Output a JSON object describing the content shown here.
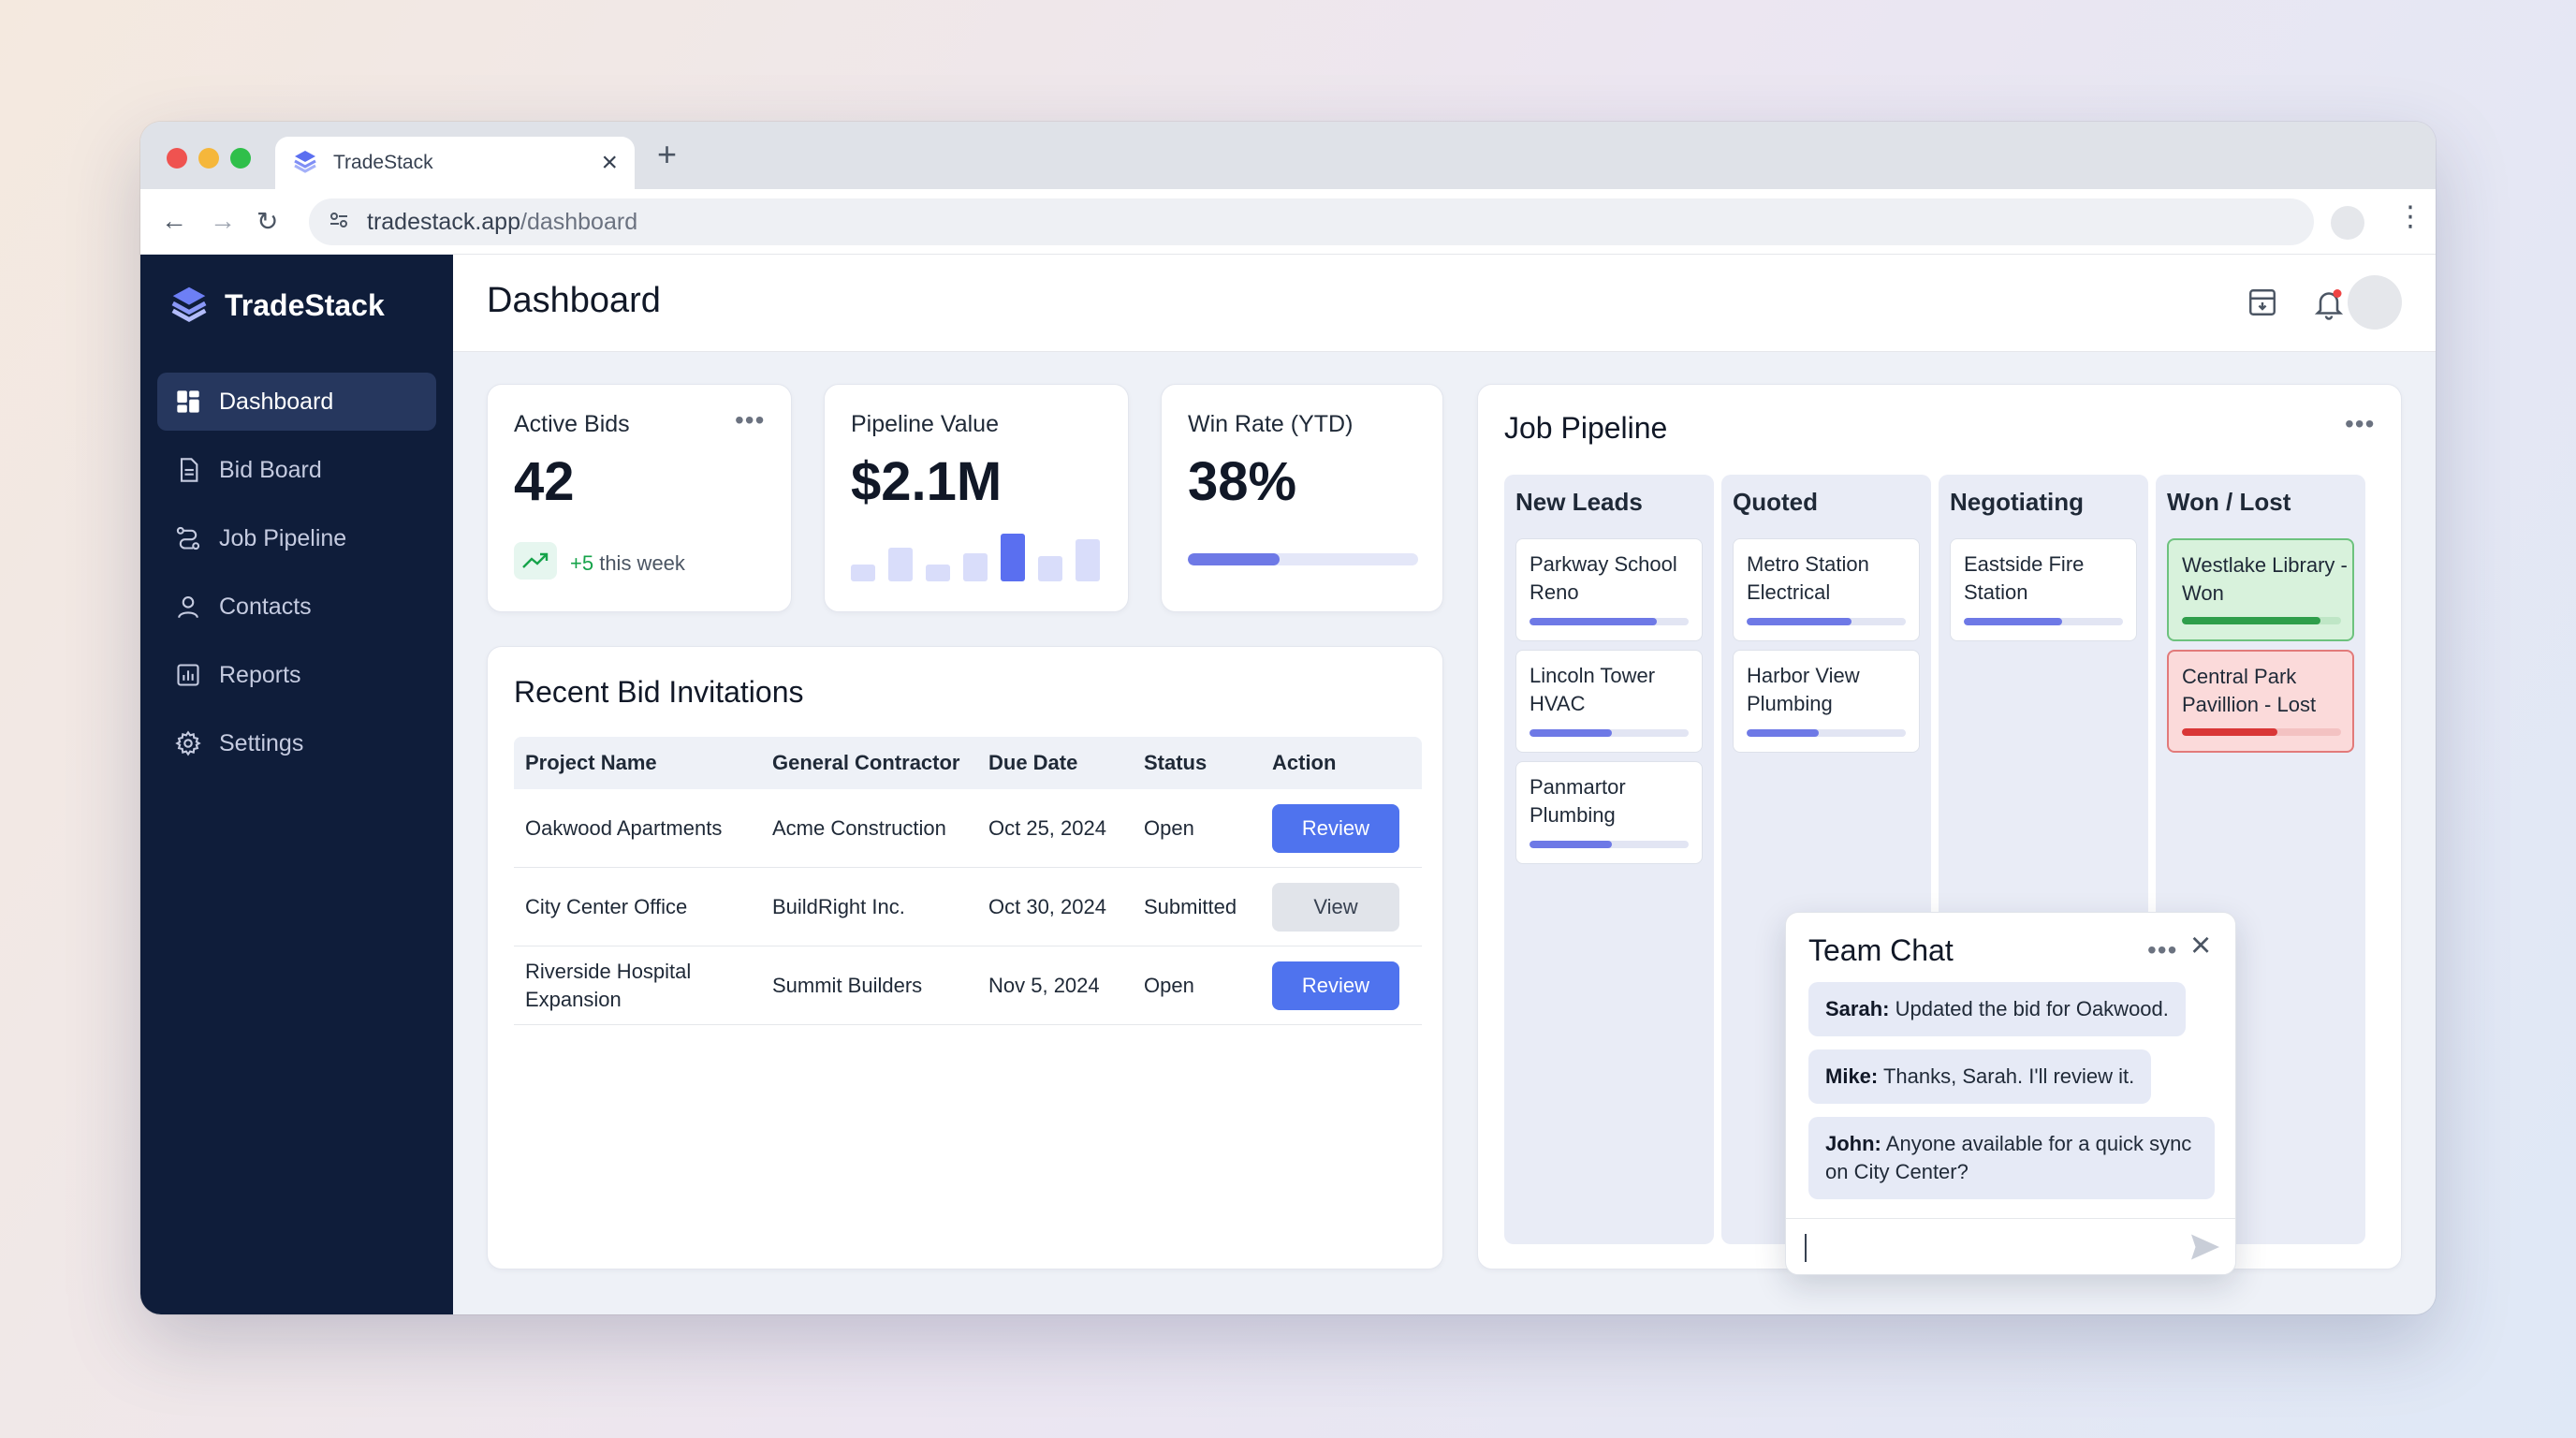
{
  "browser": {
    "tab_title": "TradeStack",
    "tab_close": "×",
    "new_tab": "+",
    "url_host": "tradestack.app",
    "url_path": "/dashboard",
    "traffic_colors": [
      "#ef5350",
      "#f5b73b",
      "#2fbf4a"
    ]
  },
  "sidebar": {
    "brand": "TradeStack",
    "items": [
      {
        "label": "Dashboard",
        "icon": "dashboard-icon",
        "active": true
      },
      {
        "label": "Bid Board",
        "icon": "document-icon",
        "active": false
      },
      {
        "label": "Job Pipeline",
        "icon": "pipeline-icon",
        "active": false
      },
      {
        "label": "Contacts",
        "icon": "user-icon",
        "active": false
      },
      {
        "label": "Reports",
        "icon": "chart-icon",
        "active": false
      },
      {
        "label": "Settings",
        "icon": "gear-icon",
        "active": false
      }
    ]
  },
  "header": {
    "title": "Dashboard",
    "icons": [
      "archive-icon",
      "bell-icon",
      "avatar"
    ],
    "notification_dot_color": "#ef4444"
  },
  "stats": {
    "active_bids": {
      "label": "Active Bids",
      "value": "42",
      "trend": "+5",
      "trend_suffix": " this week"
    },
    "pipeline_value": {
      "label": "Pipeline Value",
      "value": "$2.1M",
      "bar_levels": [
        0.3,
        0.6,
        0.3,
        0.5,
        0.85,
        0.45,
        0.75
      ],
      "highlight_index": 4
    },
    "win_rate": {
      "label": "Win Rate (YTD)",
      "value": "38%",
      "progress": 0.4
    }
  },
  "bids": {
    "title": "Recent Bid Invitations",
    "columns": [
      "Project Name",
      "General Contractor",
      "Due Date",
      "Status",
      "Action"
    ],
    "rows": [
      {
        "project": "Oakwood Apartments",
        "contractor": "Acme Construction",
        "due": "Oct 25, 2024",
        "status": "Open",
        "action": "Review",
        "primary": true
      },
      {
        "project": "City Center Office",
        "contractor": "BuildRight Inc.",
        "due": "Oct 30, 2024",
        "status": "Submitted",
        "action": "View",
        "primary": false
      },
      {
        "project": "Riverside Hospital Expansion",
        "contractor": "Summit Builders",
        "due": "Nov 5, 2024",
        "status": "Open",
        "action": "Review",
        "primary": true
      }
    ]
  },
  "pipeline": {
    "title": "Job Pipeline",
    "columns": [
      {
        "title": "New Leads",
        "cards": [
          {
            "name": "Parkway School Reno",
            "progress": 0.8,
            "state": "normal"
          },
          {
            "name": "Lincoln Tower HVAC",
            "progress": 0.52,
            "state": "normal"
          },
          {
            "name": "Panmartor Plumbing",
            "progress": 0.52,
            "state": "normal"
          }
        ]
      },
      {
        "title": "Quoted",
        "cards": [
          {
            "name": "Metro Station Electrical",
            "progress": 0.66,
            "state": "normal"
          },
          {
            "name": "Harbor View Plumbing",
            "progress": 0.45,
            "state": "normal"
          }
        ]
      },
      {
        "title": "Negotiating",
        "cards": [
          {
            "name": "Eastside Fire Station",
            "progress": 0.62,
            "state": "normal"
          }
        ]
      },
      {
        "title": "Won / Lost",
        "cards": [
          {
            "name": "Westlake Library - Won",
            "progress": 0.87,
            "state": "won"
          },
          {
            "name": "Central Park Pavillion - Lost",
            "progress": 0.6,
            "state": "lost"
          }
        ]
      }
    ]
  },
  "chat": {
    "title": "Team Chat",
    "messages": [
      {
        "author": "Sarah:",
        "text": " Updated the bid for Oakwood."
      },
      {
        "author": "Mike:",
        "text": " Thanks, Sarah. I'll review it."
      },
      {
        "author": "John:",
        "text": " Anyone available for a quick sync on City Center?"
      }
    ],
    "input_value": "",
    "close": "×"
  }
}
